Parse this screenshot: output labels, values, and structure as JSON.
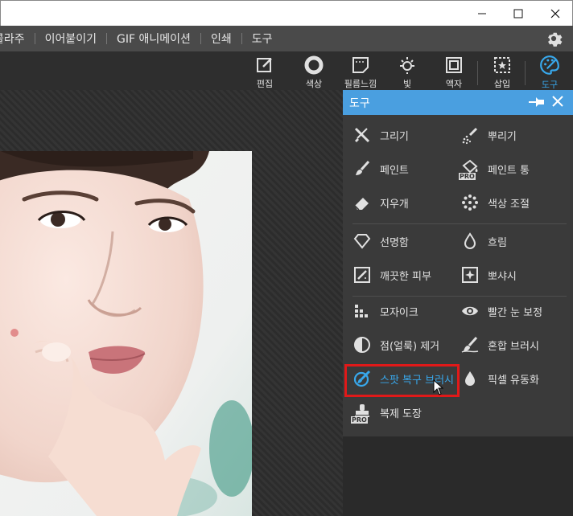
{
  "window": {
    "min": "—",
    "max": "☐",
    "close": "✕"
  },
  "menu": {
    "items": [
      "콜라주",
      "이어붙이기",
      "GIF 애니메이션",
      "인쇄",
      "도구"
    ]
  },
  "toolbar": {
    "tools": [
      {
        "label": "편집",
        "icon": "edit-icon"
      },
      {
        "label": "색상",
        "icon": "color-circle-icon"
      },
      {
        "label": "필름느낌",
        "icon": "film-icon"
      },
      {
        "label": "빛",
        "icon": "sun-icon"
      },
      {
        "label": "액자",
        "icon": "frame-icon"
      },
      {
        "label": "삽입",
        "icon": "insert-star-icon"
      },
      {
        "label": "도구",
        "icon": "palette-icon"
      }
    ],
    "active": "도구",
    "accent": "#38a8ec"
  },
  "panel": {
    "title": "도구",
    "items": [
      {
        "label": "그리기",
        "icon": "pencil-cross-icon"
      },
      {
        "label": "뿌리기",
        "icon": "spray-icon"
      },
      {
        "label": "페인트",
        "icon": "brush-icon"
      },
      {
        "label": "페인트 통",
        "icon": "paint-bucket-icon",
        "pro": "PRO"
      },
      {
        "label": "지우개",
        "icon": "eraser-icon"
      },
      {
        "label": "색상 조절",
        "icon": "dots-icon"
      },
      {
        "label": "선명함",
        "icon": "diamond-icon"
      },
      {
        "label": "흐림",
        "icon": "drop-outline-icon"
      },
      {
        "label": "깨끗한 피부",
        "icon": "clean-skin-icon"
      },
      {
        "label": "뽀샤시",
        "icon": "sparkle-icon"
      },
      {
        "label": "모자이크",
        "icon": "mosaic-icon"
      },
      {
        "label": "빨간 눈 보정",
        "icon": "eye-icon"
      },
      {
        "label": "점(얼룩) 제거",
        "icon": "half-circle-icon"
      },
      {
        "label": "혼합 브러시",
        "icon": "mix-brush-icon"
      },
      {
        "label": "스팟 복구 브러시",
        "icon": "spot-heal-icon"
      },
      {
        "label": "픽셀 유동화",
        "icon": "drop-solid-icon"
      },
      {
        "label": "복제 도장",
        "icon": "stamp-icon",
        "pro": "PRO"
      }
    ],
    "selected": "스팟 복구 브러시",
    "header_color": "#4a9fe0",
    "highlight_color": "#e01919"
  }
}
